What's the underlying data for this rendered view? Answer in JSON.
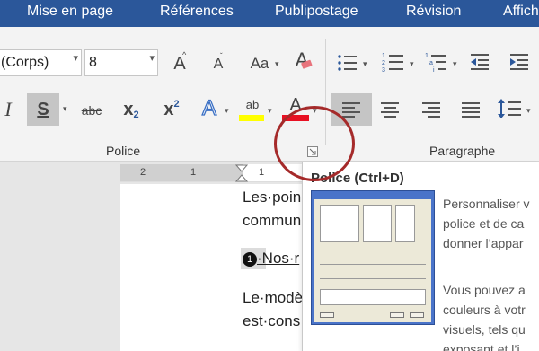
{
  "tabs": [
    "Mise en page",
    "Références",
    "Publipostage",
    "Révision",
    "Affich"
  ],
  "ribbon": {
    "font_name": "(Corps)",
    "font_size": "8",
    "grow_font_glyph": "A",
    "shrink_font_glyph": "A",
    "change_case_glyph": "Aa",
    "clear_format_glyph": "A",
    "italic_glyph": "I",
    "underline_glyph": "S",
    "strike_glyph": "abc",
    "subscript_glyph": "x",
    "subscript_digit": "2",
    "superscript_glyph": "x",
    "superscript_digit": "2",
    "effects_glyph": "A",
    "highlight_glyph": "ab",
    "font_color_glyph": "A",
    "highlight_color": "#ffff00",
    "font_color": "#e81123",
    "police_label": "Police",
    "paragraphe_label": "Paragraphe"
  },
  "ruler": {
    "n1": "2",
    "n2": "1",
    "n3": "1"
  },
  "document": {
    "line1": "Les·poin",
    "line2": "commun",
    "bullet_number": "1",
    "line3": "·Nos·r",
    "line4": "Le·modè",
    "line5": "est·cons"
  },
  "tooltip": {
    "title": "Police (Ctrl+D)",
    "text_lines": [
      "Personnaliser v",
      "police et de ca",
      "donner l’appar",
      "",
      "Vous pouvez a",
      "couleurs à votr",
      "visuels, tels qu",
      "exposant et l’i"
    ]
  },
  "colors": {
    "accent": "#2b579a",
    "ribbon_bg": "#f3f3f3",
    "circle": "#a52a2a"
  }
}
